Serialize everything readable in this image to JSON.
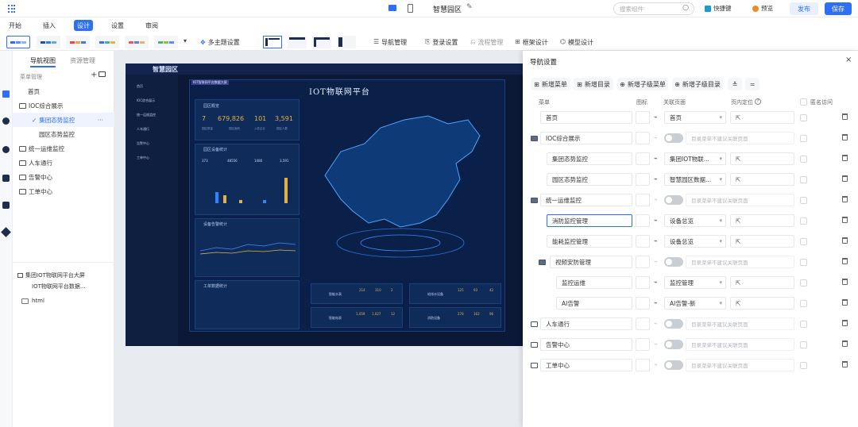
{
  "top": {
    "title": "智慧园区",
    "search_placeholder": "搜索组件",
    "shortcut": "快捷键",
    "preview": "预览",
    "publish": "发布",
    "save": "保存"
  },
  "menu": [
    "开始",
    "插入",
    "设计",
    "设置",
    "审阅"
  ],
  "menu_active": "设计",
  "toolbar": {
    "multi_theme": "多主题设置",
    "nav_manage": "导航管理",
    "login_settings": "登录设置",
    "flow_manage": "流程管理",
    "frame_design": "框架设计",
    "model_design": "模型设计"
  },
  "left": {
    "tabs": [
      "导航视图",
      "资源管理"
    ],
    "section": "菜单管理",
    "tree": [
      {
        "label": "首页",
        "level": 1
      },
      {
        "label": "IOC综合展示",
        "level": 1,
        "folder": true
      },
      {
        "label": "集团态势监控",
        "level": 2,
        "active": true
      },
      {
        "label": "园区态势监控",
        "level": 2
      },
      {
        "label": "统一运维监控",
        "level": 1,
        "folder": true
      },
      {
        "label": "人车通行",
        "level": 1,
        "folder": true
      },
      {
        "label": "告警中心",
        "level": 1,
        "folder": true
      },
      {
        "label": "工单中心",
        "level": 1,
        "folder": true
      }
    ],
    "resources": [
      "集团IOT物联网平台大屏",
      "IOT物联网平台数据...",
      "html"
    ]
  },
  "dash": {
    "brand": "智慧园区",
    "title": "IOT物联网平台",
    "small_title": "IOT智联网平台数据大屏",
    "nav": [
      "首页",
      "IOC综合展示",
      "统一运维监控",
      "人车通行",
      "告警中心",
      "工单中心"
    ],
    "overview_label": "园区概览",
    "kpis": [
      "7",
      "679,826",
      "101",
      "3,591"
    ],
    "kpi_units": [
      "个",
      "㎡",
      "座",
      "人"
    ],
    "kpi_labels": [
      "园区数量",
      "园区面积",
      "入驻企业",
      "园区人数"
    ],
    "stats_label": "园区设备统计",
    "stats_values": [
      "373",
      "48556",
      "1480",
      "3,591"
    ],
    "alarm_label": "设备告警统计",
    "workorder_label": "工单数据统计",
    "bottom": [
      {
        "name": "智能水表",
        "vals": [
          "214",
          "310",
          "2"
        ]
      },
      {
        "name": "给排水设备",
        "vals": [
          "125",
          "93",
          "42"
        ]
      },
      {
        "name": "智能电表",
        "vals": [
          "1,059",
          "1,027",
          "12"
        ]
      },
      {
        "name": "消防设备",
        "vals": [
          "278",
          "162",
          "96"
        ]
      }
    ]
  },
  "dialog": {
    "title": "导航设置",
    "actions": [
      "新增菜单",
      "新增目录",
      "新增子级菜单",
      "新增子级目录"
    ],
    "columns": [
      "菜单",
      "图标",
      "关联页面",
      "页内定位",
      "匿名访问"
    ],
    "disabled_hint": "目录菜单不建议关联页面",
    "rows": [
      {
        "name": "首页",
        "indent": 0,
        "folder": false,
        "page": "首页",
        "active": false
      },
      {
        "name": "IOC综合展示",
        "indent": 0,
        "folder": true,
        "page": "",
        "active": false
      },
      {
        "name": "集团态势监控",
        "indent": 1,
        "folder": false,
        "page": "集团IOT物联...",
        "active": false
      },
      {
        "name": "园区态势监控",
        "indent": 1,
        "folder": false,
        "page": "智慧园区数据...",
        "active": false
      },
      {
        "name": "统一运维监控",
        "indent": 0,
        "folder": true,
        "page": "",
        "active": false
      },
      {
        "name": "消防监控管理",
        "indent": 1,
        "folder": false,
        "page": "设备总览",
        "active": true
      },
      {
        "name": "能耗监控管理",
        "indent": 1,
        "folder": false,
        "page": "设备总览",
        "active": false
      },
      {
        "name": "视频安防管理",
        "indent": 1,
        "folder": true,
        "page": "",
        "active": false
      },
      {
        "name": "监控运维",
        "indent": 2,
        "folder": false,
        "page": "监控管理",
        "active": false
      },
      {
        "name": "AI告警",
        "indent": 2,
        "folder": false,
        "page": "AI告警-新",
        "active": false
      },
      {
        "name": "人车通行",
        "indent": 0,
        "folder": true,
        "page": "",
        "active": false
      },
      {
        "name": "告警中心",
        "indent": 0,
        "folder": true,
        "page": "",
        "active": false
      },
      {
        "name": "工单中心",
        "indent": 0,
        "folder": true,
        "page": "",
        "active": false
      }
    ]
  },
  "colors": {
    "primary": "#2d6ff7",
    "dash_bg": "#0b1836"
  }
}
